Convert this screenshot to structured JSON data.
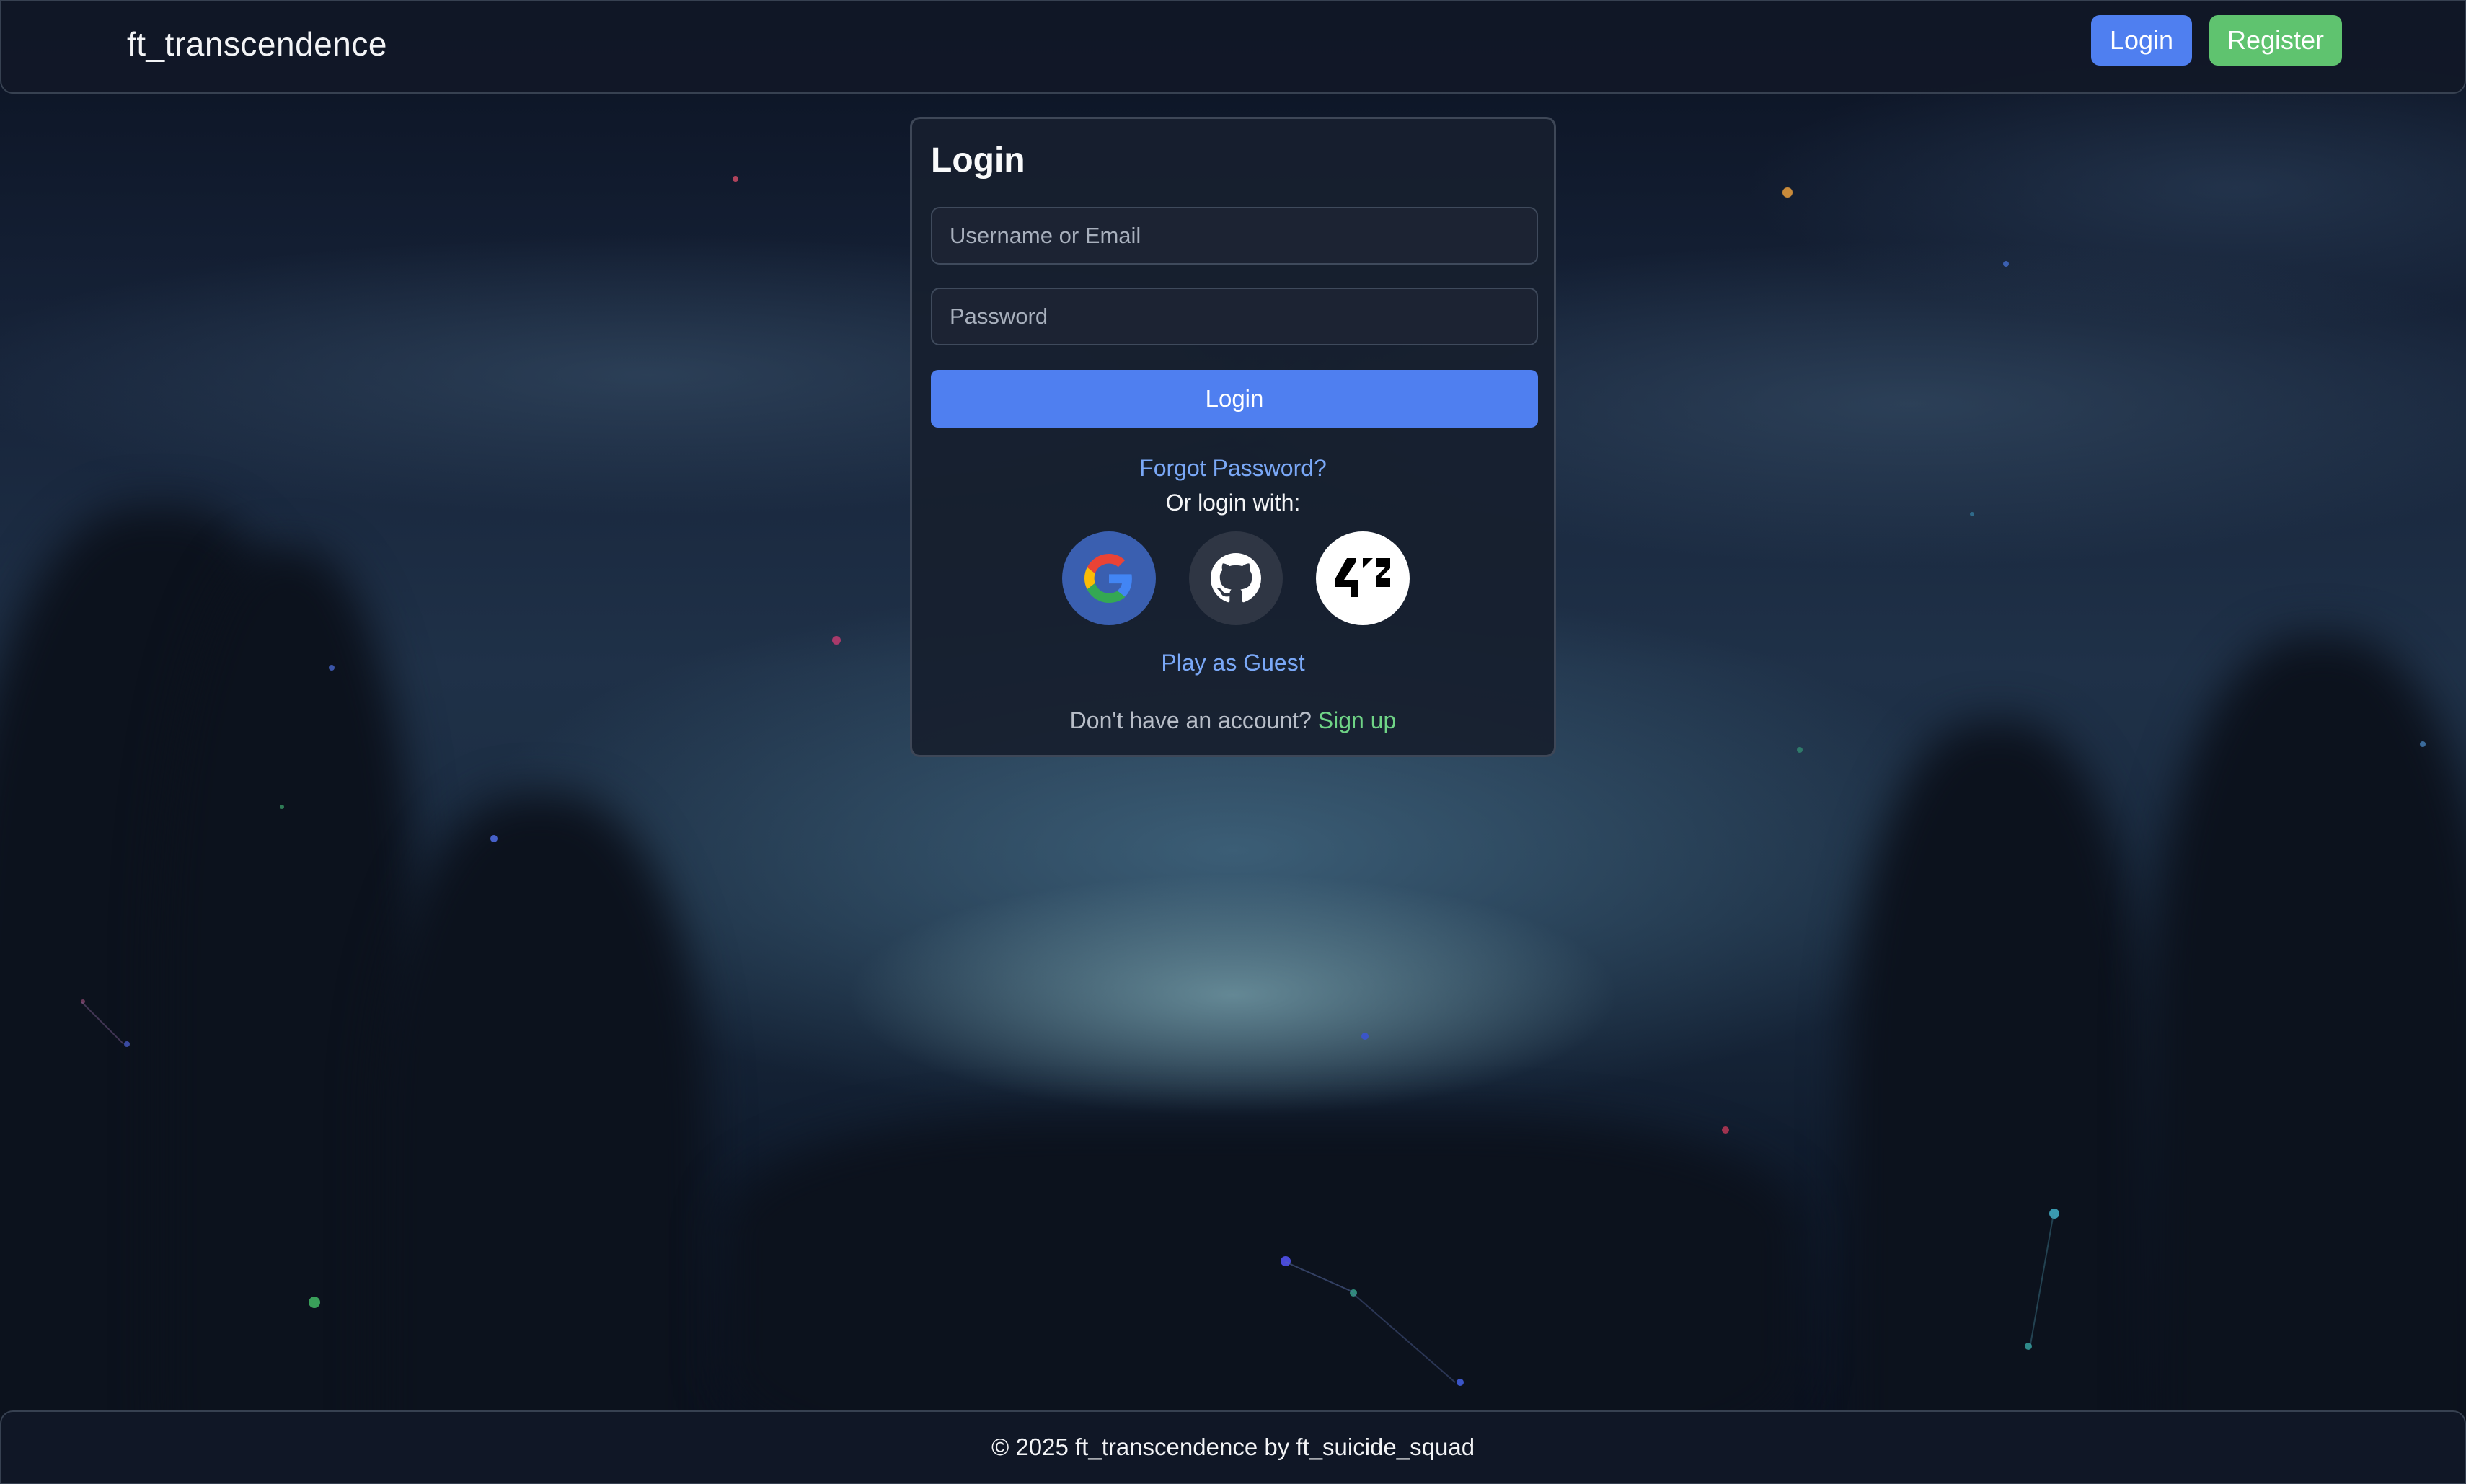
{
  "navbar": {
    "brand": "ft_transcendence",
    "login_label": "Login",
    "register_label": "Register"
  },
  "login_card": {
    "title": "Login",
    "username_placeholder": "Username or Email",
    "password_placeholder": "Password",
    "submit_label": "Login",
    "forgot_password": "Forgot Password?",
    "or_login_with": "Or login with:",
    "social_providers": [
      {
        "name": "Google",
        "icon": "google-icon"
      },
      {
        "name": "GitHub",
        "icon": "github-icon"
      },
      {
        "name": "42",
        "icon": "42-icon"
      }
    ],
    "guest_label": "Play as Guest",
    "no_account_text": "Don't have an account?",
    "signup_label": "Sign up"
  },
  "footer": {
    "text": "© 2025 ft_transcendence by ft_suicide_squad"
  },
  "colors": {
    "primary": "#4f7ff0",
    "success": "#5fc36f",
    "link": "#7aa8f7",
    "signup_link": "#6fd486",
    "surface": "#171f2e"
  }
}
